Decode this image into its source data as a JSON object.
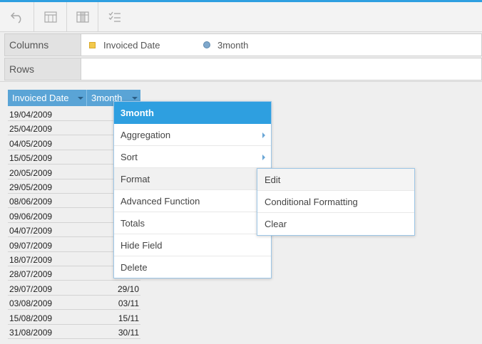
{
  "colors": {
    "accent": "#2e9fe0",
    "header_cell": "#5aa4d6"
  },
  "toolbar": {
    "icons": [
      "undo-icon",
      "table-layout-icon",
      "column-layout-icon",
      "checklist-icon"
    ]
  },
  "shelves": {
    "columns": {
      "label": "Columns",
      "fields": [
        {
          "name": "Invoiced Date",
          "icon": "dimension-square-icon"
        },
        {
          "name": "3month",
          "icon": "measure-dot-icon"
        }
      ]
    },
    "rows": {
      "label": "Rows"
    }
  },
  "grid": {
    "headers": [
      "Invoiced Date",
      "3month"
    ],
    "rows": [
      [
        "19/04/2009",
        ""
      ],
      [
        "25/04/2009",
        ""
      ],
      [
        "04/05/2009",
        ""
      ],
      [
        "15/05/2009",
        ""
      ],
      [
        "20/05/2009",
        ""
      ],
      [
        "29/05/2009",
        ""
      ],
      [
        "08/06/2009",
        ""
      ],
      [
        "09/06/2009",
        ""
      ],
      [
        "04/07/2009",
        ""
      ],
      [
        "09/07/2009",
        ""
      ],
      [
        "18/07/2009",
        ""
      ],
      [
        "28/07/2009",
        ""
      ],
      [
        "29/07/2009",
        "29/10"
      ],
      [
        "03/08/2009",
        "03/11"
      ],
      [
        "15/08/2009",
        "15/11"
      ],
      [
        "31/08/2009",
        "30/11"
      ],
      [
        "",
        ""
      ]
    ]
  },
  "context_menu": {
    "title": "3month",
    "items": [
      {
        "label": "Aggregation",
        "has_submenu": true
      },
      {
        "label": "Sort",
        "has_submenu": true
      },
      {
        "label": "Format",
        "has_submenu": false,
        "active": true
      },
      {
        "label": "Advanced Function",
        "has_submenu": false
      },
      {
        "label": "Totals",
        "has_submenu": false
      },
      {
        "label": "Hide Field",
        "has_submenu": false
      },
      {
        "label": "Delete",
        "has_submenu": false
      }
    ]
  },
  "format_submenu": {
    "items": [
      "Edit",
      "Conditional Formatting",
      "Clear"
    ]
  }
}
